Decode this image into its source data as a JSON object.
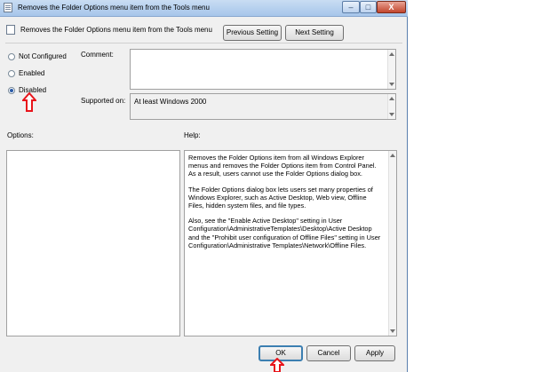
{
  "window": {
    "title": "Removes the Folder Options menu item from the Tools menu",
    "controls": [
      "–",
      "□",
      "X"
    ]
  },
  "header": {
    "policy_name": "Removes the Folder Options menu item from the Tools menu",
    "prev_label": "Previous Setting",
    "next_label": "Next Setting"
  },
  "state": {
    "options": [
      {
        "label": "Not Configured",
        "selected": false
      },
      {
        "label": "Enabled",
        "selected": false
      },
      {
        "label": "Disabled",
        "selected": true
      }
    ]
  },
  "comment": {
    "label": "Comment:",
    "value": ""
  },
  "supported": {
    "label": "Supported on:",
    "value": "At least Windows 2000"
  },
  "options_label": "Options:",
  "help": {
    "label": "Help:",
    "paragraphs": [
      "Removes the Folder Options item from all Windows Explorer menus and removes the Folder Options item from Control Panel. As a result, users cannot use the Folder Options dialog box.",
      "The Folder Options dialog box lets users set many properties of Windows Explorer, such as Active Desktop, Web view, Offline Files, hidden system files, and file types.",
      "Also, see the \"Enable Active Desktop\" setting in User Configuration\\AdministrativeTemplates\\Desktop\\Active Desktop and the \"Prohibit user configuration of Offline Files\" setting in User Configuration\\Administrative Templates\\Network\\Offline Files."
    ]
  },
  "footer": {
    "ok_label": "OK",
    "cancel_label": "Cancel",
    "apply_label": "Apply"
  },
  "colors": {
    "annotation_arrow": "#e8141b",
    "titlebar": "#b8d1ef"
  }
}
